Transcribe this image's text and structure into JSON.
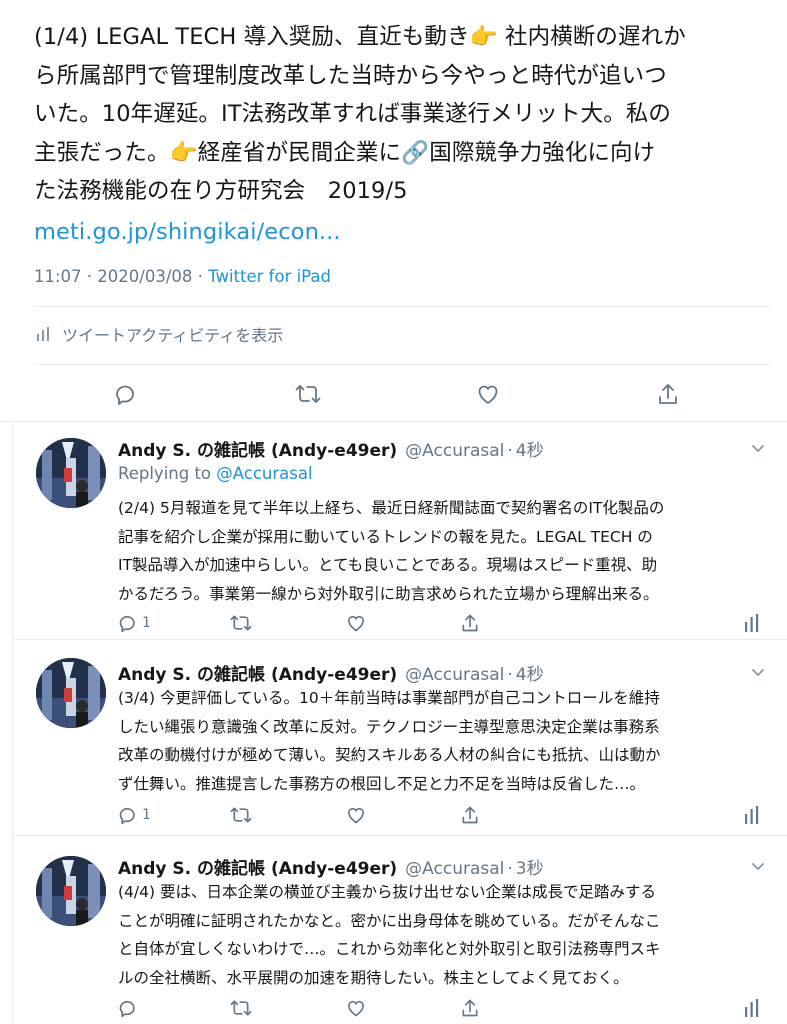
{
  "main_tweet": {
    "lines": [
      "(1/4) LEGAL TECH 導入奨励、直近も動き👉 社内横断の遅れか",
      "ら所属部門で管理制度改革した当時から今やっと時代が追いつ",
      "いた。10年遅延。IT法務改革すれば事業遂行メリット大。私の",
      "主張だった。👉経産省が民間企業に🔗国際競争力強化に向け",
      "た法務機能の在り方研究会　2019/5"
    ],
    "link": "meti.go.jp/shingikai/econ...",
    "time": "11:07 · 2020/03/08 · ",
    "source": "Twitter for iPad",
    "activity_label": "ツイートアクティビティを表示"
  },
  "replies": [
    {
      "name": "Andy S. の雑記帳 (Andy-e49er)",
      "handle": "@Accurasal",
      "time": "4秒",
      "replying_prefix": "Replying to ",
      "replying_to": "@Accurasal",
      "lines": [
        "(2/4) 5月報道を見て半年以上経ち、最近日経新聞誌面で契約署名のIT化製品の",
        "記事を紹介し企業が採用に動いているトレンドの報を見た。LEGAL TECH の",
        "IT製品導入が加速中らしい。とても良いことである。現場はスピード重視、助",
        "かるだろう。事業第一線から対外取引に助言求められた立場から理解出来る。"
      ],
      "reply_count": "1"
    },
    {
      "name": "Andy S. の雑記帳 (Andy-e49er)",
      "handle": "@Accurasal",
      "time": "4秒",
      "lines": [
        "(3/4) 今更評価している。10＋年前当時は事業部門が自己コントロールを維持",
        "したい縄張り意識強く改革に反対。テクノロジー主導型意思決定企業は事務系",
        "改革の動機付けが極めて薄い。契約スキルある人材の糾合にも抵抗、山は動か",
        "ず仕舞い。推進提言した事務方の根回し不足と力不足を当時は反省した…。"
      ],
      "reply_count": "1"
    },
    {
      "name": "Andy S. の雑記帳 (Andy-e49er)",
      "handle": "@Accurasal",
      "time": "3秒",
      "lines": [
        "(4/4) 要は、日本企業の横並び主義から抜け出せない企業は成長で足踏みする",
        "ことが明確に証明されたかなと。密かに出身母体を眺めている。だがそんなこ",
        "と自体が宜しくないわけで…。これから効率化と対外取引と取引法務専門スキ",
        "ルの全社横断、水平展開の加速を期待したい。株主としてよく見ておく。"
      ],
      "reply_count": ""
    }
  ],
  "icons": {
    "reply": "reply-icon",
    "retweet": "retweet-icon",
    "like": "heart-icon",
    "share": "share-icon",
    "analytics": "analytics-icon",
    "menu": "chevron-down-icon"
  },
  "colors": {
    "link": "#1b95e0",
    "secondary_text": "#657786",
    "divider": "#e6ecf0",
    "text": "#14171a"
  }
}
